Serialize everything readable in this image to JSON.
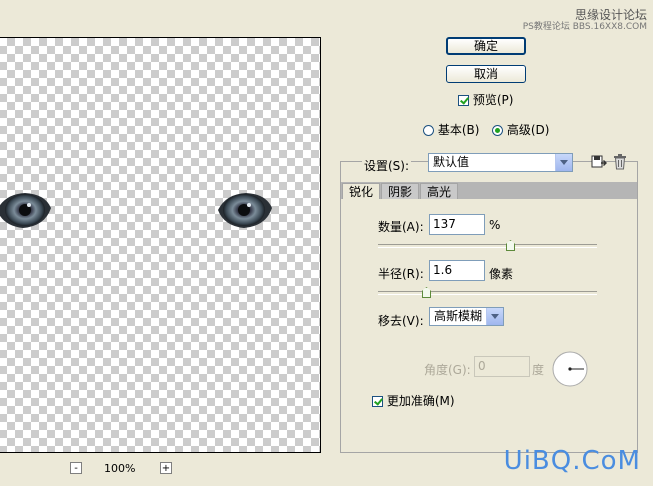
{
  "watermark": {
    "top": "思缘设计论坛",
    "top_sub": "PS教程论坛 BBS.16XX8.COM",
    "bottom": "UiBQ.CoM"
  },
  "preview": {
    "zoom_out": "-",
    "zoom_level": "100%",
    "zoom_in": "+"
  },
  "buttons": {
    "ok": "确定",
    "cancel": "取消"
  },
  "preview_checkbox": {
    "label": "预览(P)",
    "checked": true
  },
  "mode": {
    "basic": "基本(B)",
    "advanced": "高级(D)",
    "selected": "advanced"
  },
  "settings": {
    "label": "设置(S):",
    "value": "默认值"
  },
  "tabs": [
    {
      "label": "锐化",
      "active": true
    },
    {
      "label": "阴影",
      "active": false
    },
    {
      "label": "高光",
      "active": false
    }
  ],
  "amount": {
    "label": "数量(A):",
    "value": "137",
    "unit": "%",
    "fraction": 0.61
  },
  "radius": {
    "label": "半径(R):",
    "value": "1.6",
    "unit": "像素",
    "fraction": 0.21
  },
  "remove": {
    "label": "移去(V):",
    "value": "高斯模糊"
  },
  "angle": {
    "label": "角度(G):",
    "value": "0",
    "unit": "度"
  },
  "more_accurate": {
    "label": "更加准确(M)",
    "checked": true
  }
}
